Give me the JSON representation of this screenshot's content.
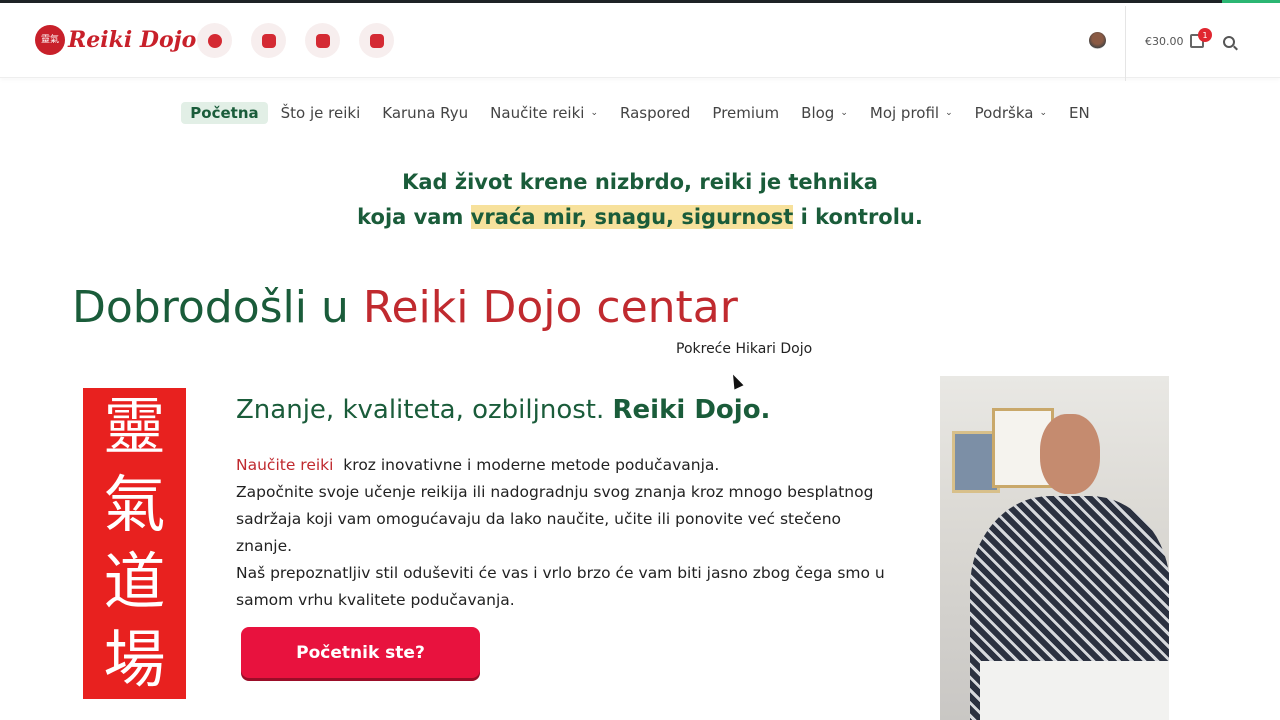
{
  "header": {
    "logo_text": "Reiki Dojo",
    "logo_seal": "靈氣道場",
    "social": [
      "facebook",
      "instagram",
      "youtube",
      "threads"
    ],
    "cart_total": "€30.00",
    "cart_count": "1"
  },
  "nav": [
    {
      "label": "Početna",
      "active": true
    },
    {
      "label": "Što je reiki"
    },
    {
      "label": "Karuna Ryu"
    },
    {
      "label": "Naučite reiki",
      "dropdown": true
    },
    {
      "label": "Raspored"
    },
    {
      "label": "Premium"
    },
    {
      "label": "Blog",
      "dropdown": true
    },
    {
      "label": "Moj profil",
      "dropdown": true
    },
    {
      "label": "Podrška",
      "dropdown": true
    },
    {
      "label": "EN"
    }
  ],
  "tagline": {
    "line1": "Kad život krene nizbrdo, reiki je tehnika",
    "line2_pre": "koja vam ",
    "line2_highlight": "vraća mir, snagu, sigurnost",
    "line2_post": " i kontrolu."
  },
  "hero": {
    "title_green": "Dobrodošli u ",
    "title_red": "Reiki Dojo centar",
    "powered": "Pokreće Hikari Dojo",
    "banner_chars": [
      "靈",
      "氣",
      "道",
      "場"
    ]
  },
  "intro": {
    "heading": "Znanje, kvaliteta, ozbiljnost. ",
    "heading_bold": "Reiki Dojo.",
    "link": "Naučite reiki",
    "p1": "  kroz inovativne i moderne metode podučavanja.",
    "p2": "Započnite svoje učenje reikija ili nadogradnju svog znanja kroz mnogo besplatnog sadržaja koji vam omogućavaju da lako naučite, učite ili ponovite već stečeno znanje.",
    "p3": "Naš prepoznatljiv stil oduševiti će vas i vrlo brzo će vam biti jasno zbog čega smo u samom vrhu kvalitete podučavanja.",
    "cta": "Početnik ste?"
  }
}
